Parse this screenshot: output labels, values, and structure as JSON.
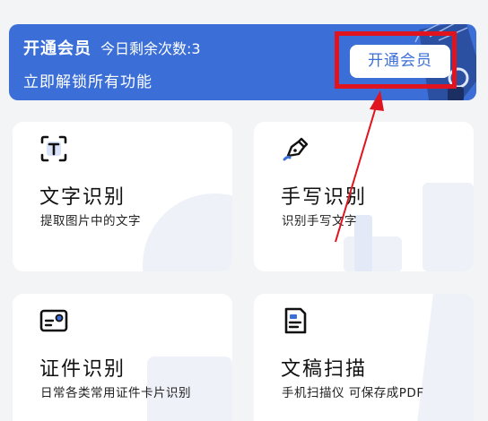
{
  "banner": {
    "title": "开通会员",
    "count_text": "今日剩余次数:3",
    "subtitle": "立即解锁所有功能",
    "button_label": "开通会员"
  },
  "features": [
    {
      "title": "文字识别",
      "desc": "提取图片中的文字",
      "icon": "text-scan-icon"
    },
    {
      "title": "手写识别",
      "desc": "识别手写文字",
      "icon": "pen-icon"
    },
    {
      "title": "证件识别",
      "desc": "日常各类常用证件卡片识别",
      "icon": "id-card-icon"
    },
    {
      "title": "文稿扫描",
      "desc": "手机扫描仪 可保存成PDF",
      "icon": "document-icon"
    }
  ],
  "colors": {
    "brand": "#3b6fd7",
    "annotation": "#e0141e",
    "page_background": "#f3f4f6"
  }
}
